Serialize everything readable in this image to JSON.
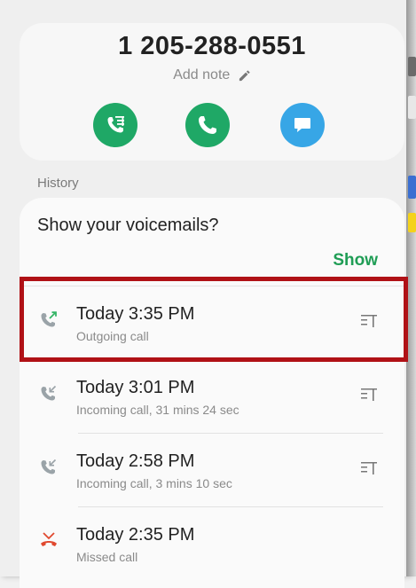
{
  "contact": {
    "phone_number": "1 205-288-0551",
    "add_note_label": "Add note"
  },
  "actions": [
    {
      "name": "call-with-message",
      "icon": "phone-message-icon",
      "color": "#1fa866"
    },
    {
      "name": "call",
      "icon": "phone-icon",
      "color": "#1fa866"
    },
    {
      "name": "message",
      "icon": "chat-icon",
      "color": "#37a6e6"
    }
  ],
  "history": {
    "label": "History",
    "voicemail_prompt": "Show your voicemails?",
    "voicemail_show_label": "Show",
    "calls": [
      {
        "time": "Today 3:35 PM",
        "detail": "Outgoing call",
        "type": "outgoing",
        "icon": "outgoing-call-icon",
        "highlighted": true
      },
      {
        "time": "Today 3:01 PM",
        "detail": "Incoming call, 31 mins 24 sec",
        "type": "incoming",
        "icon": "incoming-call-icon"
      },
      {
        "time": "Today 2:58 PM",
        "detail": "Incoming call, 3 mins 10 sec",
        "type": "incoming",
        "icon": "incoming-call-icon"
      },
      {
        "time": "Today 2:35 PM",
        "detail": "Missed call",
        "type": "missed",
        "icon": "missed-call-icon"
      }
    ]
  },
  "colors": {
    "accent_green": "#1f9d55",
    "highlight_red": "#b01116",
    "missed_red": "#e0492f"
  }
}
